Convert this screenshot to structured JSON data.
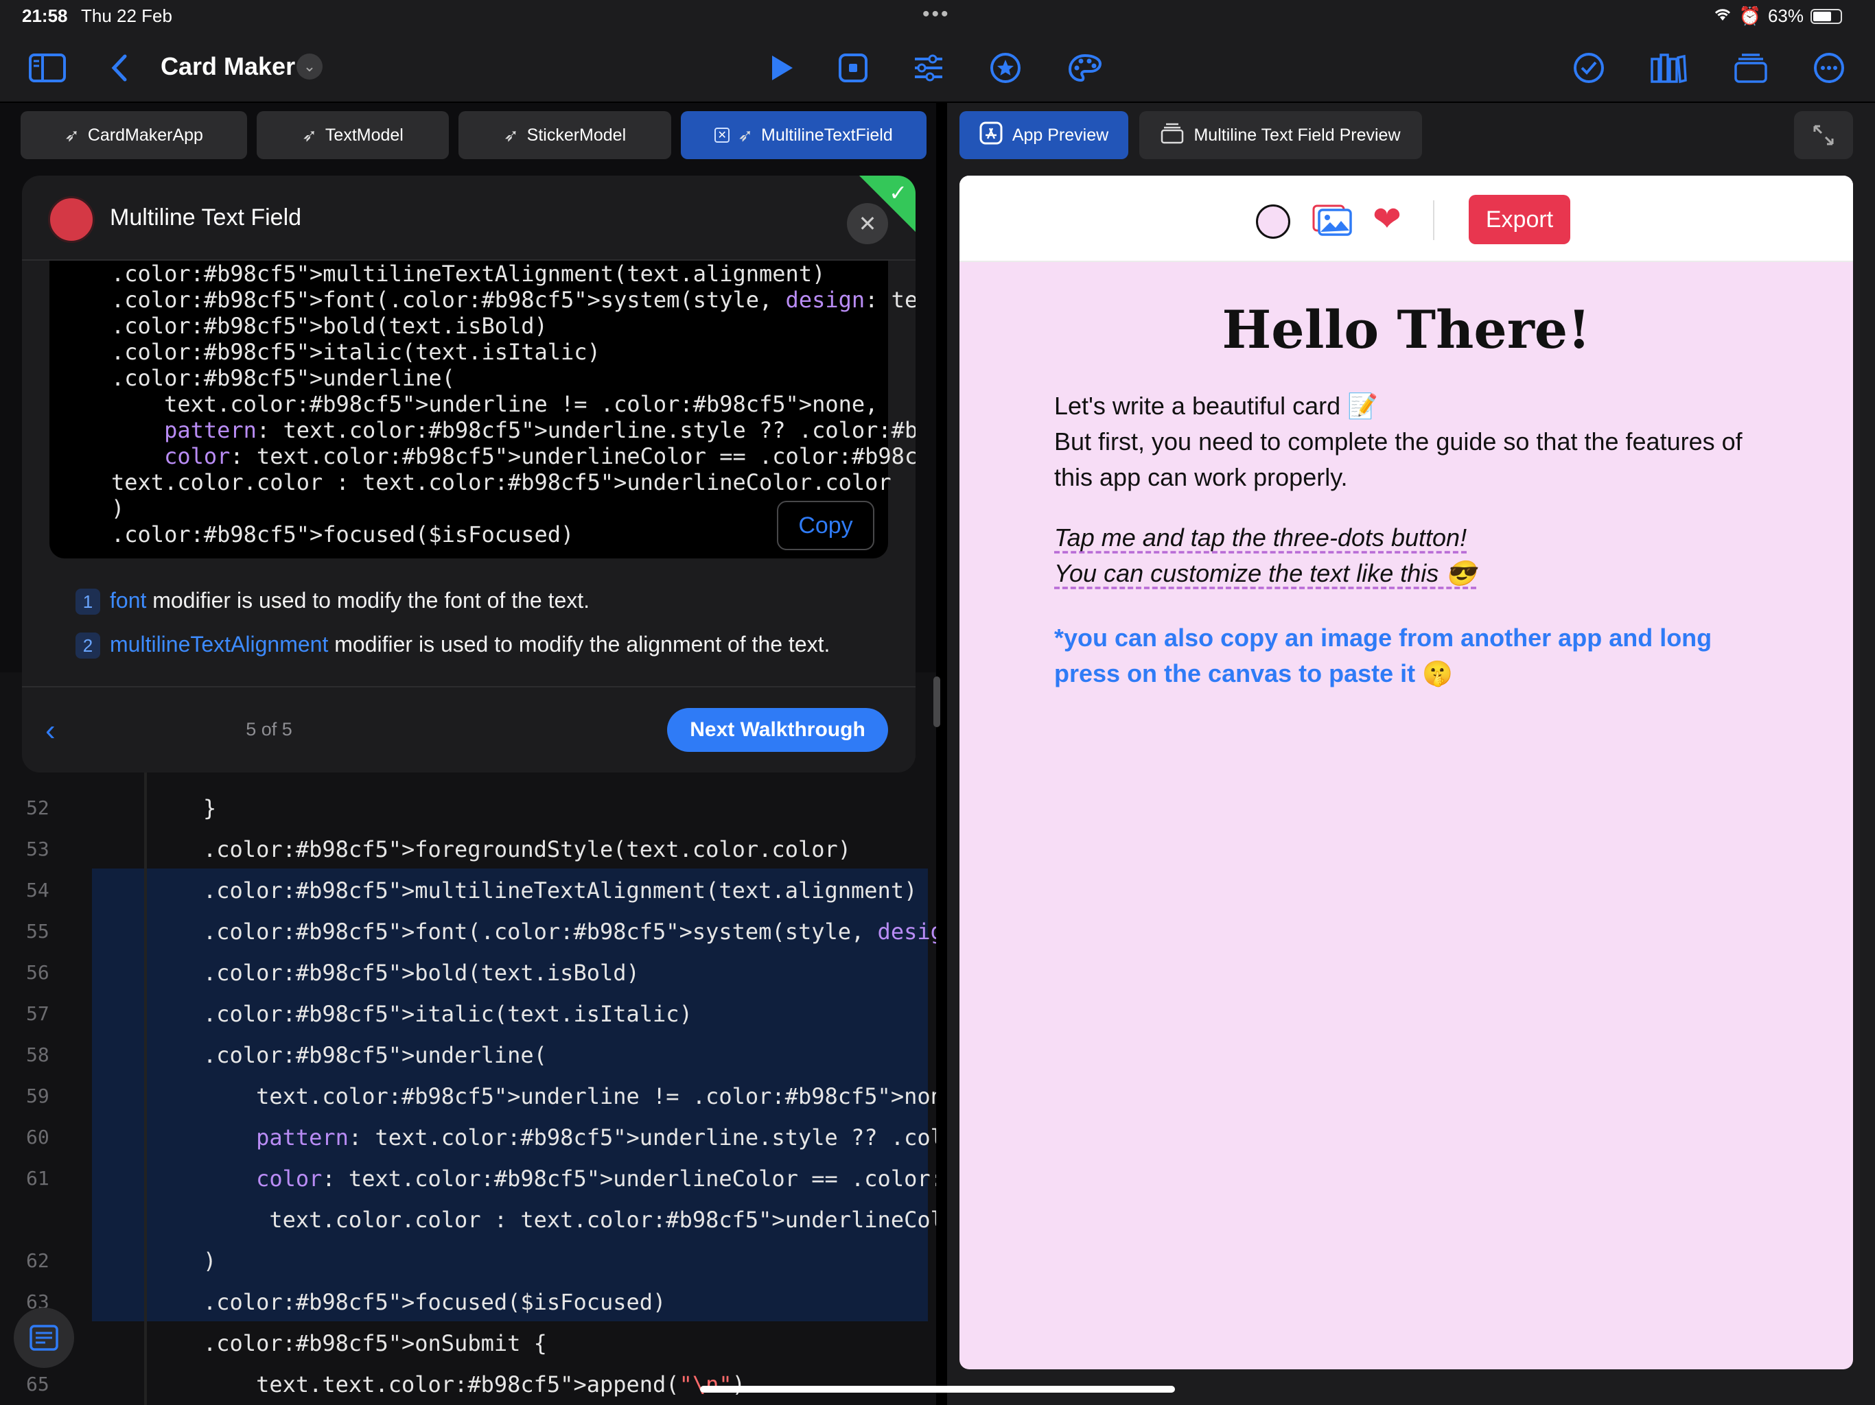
{
  "status_bar": {
    "time": "21:58",
    "date": "Thu 22 Feb",
    "battery": "63%"
  },
  "toolbar": {
    "title": "Card Maker",
    "icons": [
      "sidebar-icon",
      "back-icon",
      "play-icon",
      "stop-icon",
      "sliders-icon",
      "star-icon",
      "palette-icon",
      "check-icon",
      "library-icon",
      "windows-icon",
      "more-icon"
    ]
  },
  "left_tabs": [
    {
      "label": "CardMakerApp"
    },
    {
      "label": "TextModel"
    },
    {
      "label": "StickerModel"
    },
    {
      "label": "MultilineTextField"
    }
  ],
  "walkthrough": {
    "title": "Multiline Text Field",
    "code_lines": [
      ".multilineTextAlignment(text.alignment)",
      ".font(.system(style, design: text.typography))",
      ".bold(text.isBold)",
      ".italic(text.isItalic)",
      ".underline(",
      "    text.underline != .none,",
      "    pattern: text.underline.style ?? .solid,",
      "    color: text.underlineColor == .initial ?",
      "text.color.color : text.underlineColor.color",
      ")",
      ".focused($isFocused)"
    ],
    "copy_label": "Copy",
    "explanations": [
      {
        "num": "1",
        "keyword": "font",
        "text": " modifier is used to modify the font of the text."
      },
      {
        "num": "2",
        "keyword": "multilineTextAlignment",
        "text": " modifier is used to modify the alignment of the text."
      }
    ],
    "page": "5 of 5",
    "next_label": "Next Walkthrough"
  },
  "editor": {
    "lines": [
      {
        "num": "52",
        "code": "}"
      },
      {
        "num": "53",
        "code": ".foregroundStyle(text.color.color)"
      },
      {
        "num": "54",
        "code": ".multilineTextAlignment(text.alignment)"
      },
      {
        "num": "55",
        "code": ".font(.system(style, design: text.typography))"
      },
      {
        "num": "56",
        "code": ".bold(text.isBold)"
      },
      {
        "num": "57",
        "code": ".italic(text.isItalic)"
      },
      {
        "num": "58",
        "code": ".underline("
      },
      {
        "num": "59",
        "code": "    text.underline != .none,"
      },
      {
        "num": "60",
        "code": "    pattern: text.underline.style ?? .solid,"
      },
      {
        "num": "61",
        "code": "    color: text.underlineColor == .initial ?"
      },
      {
        "num": "",
        "code": "     text.color.color : text.underlineColor.color"
      },
      {
        "num": "62",
        "code": ")"
      },
      {
        "num": "63",
        "code": ".focused($isFocused)"
      },
      {
        "num": "",
        "code": ".onSubmit {"
      },
      {
        "num": "65",
        "code": "    text.text.append(\"\\n\")"
      }
    ]
  },
  "right_tabs": [
    {
      "label": "App Preview"
    },
    {
      "label": "Multiline Text Field Preview"
    }
  ],
  "preview": {
    "export_label": "Export",
    "heading": "Hello There!",
    "para1_line1": "Let's write a beautiful card 📝",
    "para1_line2": "But first, you need to complete the guide so that the features of this app can work properly.",
    "italic_line1": "Tap me and tap the three-dots button!",
    "italic_line2": "You can customize the text like this 😎",
    "blue_text": "*you can also copy an image from another app and long press on the canvas to paste it 🤫"
  },
  "colors": {
    "accent": "#2f7bf6",
    "export": "#e8364f",
    "canvas": "#f7ddf6"
  }
}
